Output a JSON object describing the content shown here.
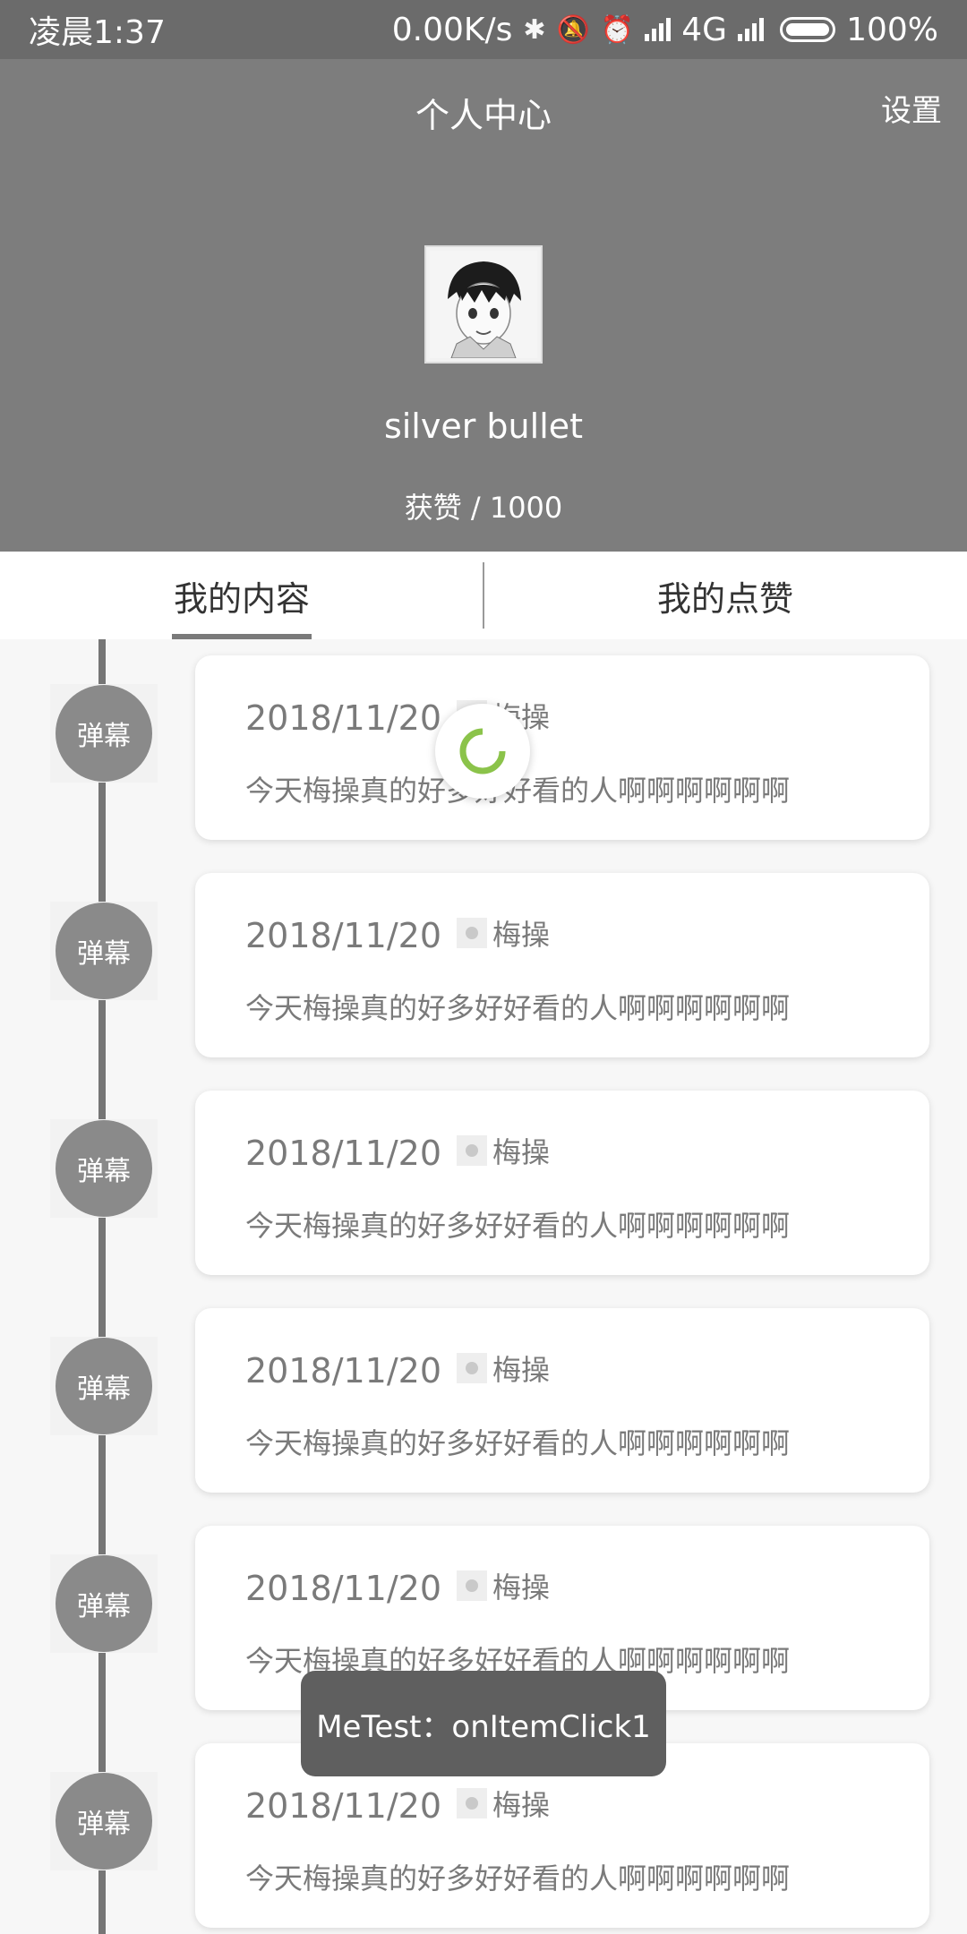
{
  "status_bar": {
    "time": "凌晨1:37",
    "speed": "0.00K/s",
    "network": "4G",
    "battery": "100%"
  },
  "header": {
    "title": "个人中心",
    "settings_label": "设置",
    "username": "silver bullet",
    "likes": "获赞 / 1000"
  },
  "tabs": [
    {
      "label": "我的内容",
      "active": true
    },
    {
      "label": "我的点赞",
      "active": false
    }
  ],
  "items": [
    {
      "badge": "弹幕",
      "date": "2018/11/20",
      "location": "梅操",
      "text": "今天梅操真的好多好好看的人啊啊啊啊啊啊"
    },
    {
      "badge": "弹幕",
      "date": "2018/11/20",
      "location": "梅操",
      "text": "今天梅操真的好多好好看的人啊啊啊啊啊啊"
    },
    {
      "badge": "弹幕",
      "date": "2018/11/20",
      "location": "梅操",
      "text": "今天梅操真的好多好好看的人啊啊啊啊啊啊"
    },
    {
      "badge": "弹幕",
      "date": "2018/11/20",
      "location": "梅操",
      "text": "今天梅操真的好多好好看的人啊啊啊啊啊啊"
    },
    {
      "badge": "弹幕",
      "date": "2018/11/20",
      "location": "梅操",
      "text": "今天梅操真的好多好好看的人啊啊啊啊啊啊"
    },
    {
      "badge": "弹幕",
      "date": "2018/11/20",
      "location": "梅操",
      "text": "今天梅操真的好多好好看的人啊啊啊啊啊啊"
    }
  ],
  "toast": "MeTest：onItemClick1",
  "colors": {
    "header_bg": "#7d7d7d",
    "status_bg": "#6b6b6b",
    "spinner": "#8bc34a"
  }
}
